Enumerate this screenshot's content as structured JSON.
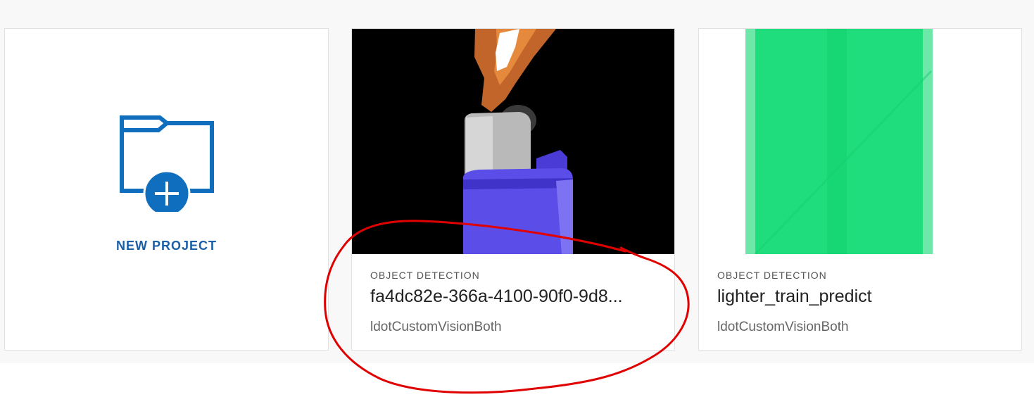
{
  "new_project": {
    "label": "NEW PROJECT"
  },
  "projects": [
    {
      "type": "OBJECT DETECTION",
      "name": "fa4dc82e-366a-4100-90f0-9d8...",
      "owner": "ldotCustomVisionBoth",
      "thumbnail": "lighter-flame-image"
    },
    {
      "type": "OBJECT DETECTION",
      "name": "lighter_train_predict",
      "owner": "ldotCustomVisionBoth",
      "thumbnail": "green-lighter-image"
    }
  ],
  "colors": {
    "accent": "#106ebe",
    "annotation": "#e00000"
  }
}
